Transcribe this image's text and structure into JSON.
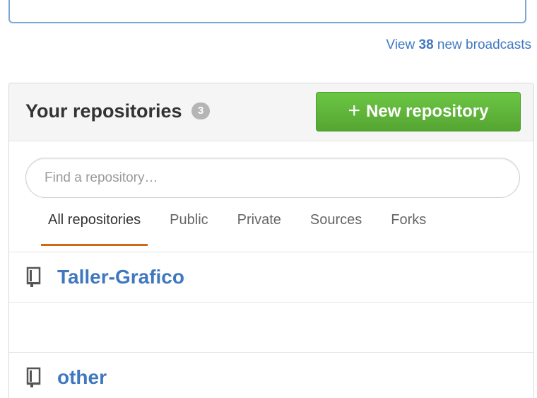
{
  "broadcasts": {
    "prefix": "View",
    "count": "38",
    "suffix": "new broadcasts"
  },
  "repositories_panel": {
    "title": "Your repositories",
    "count": "3",
    "new_button_label": "New repository",
    "search_placeholder": "Find a repository…",
    "tabs": [
      {
        "label": "All repositories",
        "selected": true
      },
      {
        "label": "Public",
        "selected": false
      },
      {
        "label": "Private",
        "selected": false
      },
      {
        "label": "Sources",
        "selected": false
      },
      {
        "label": "Forks",
        "selected": false
      }
    ],
    "repos": [
      {
        "name": "Taller-Grafico",
        "icon": "repo-book-icon"
      },
      {
        "name": "",
        "icon": ""
      },
      {
        "name": "other",
        "icon": "repo-book-icon"
      }
    ]
  },
  "colors": {
    "link": "#4078c0",
    "button_green": "#6cc644",
    "tab_underline": "#d26911",
    "counter_bg": "#b5b5b5"
  }
}
